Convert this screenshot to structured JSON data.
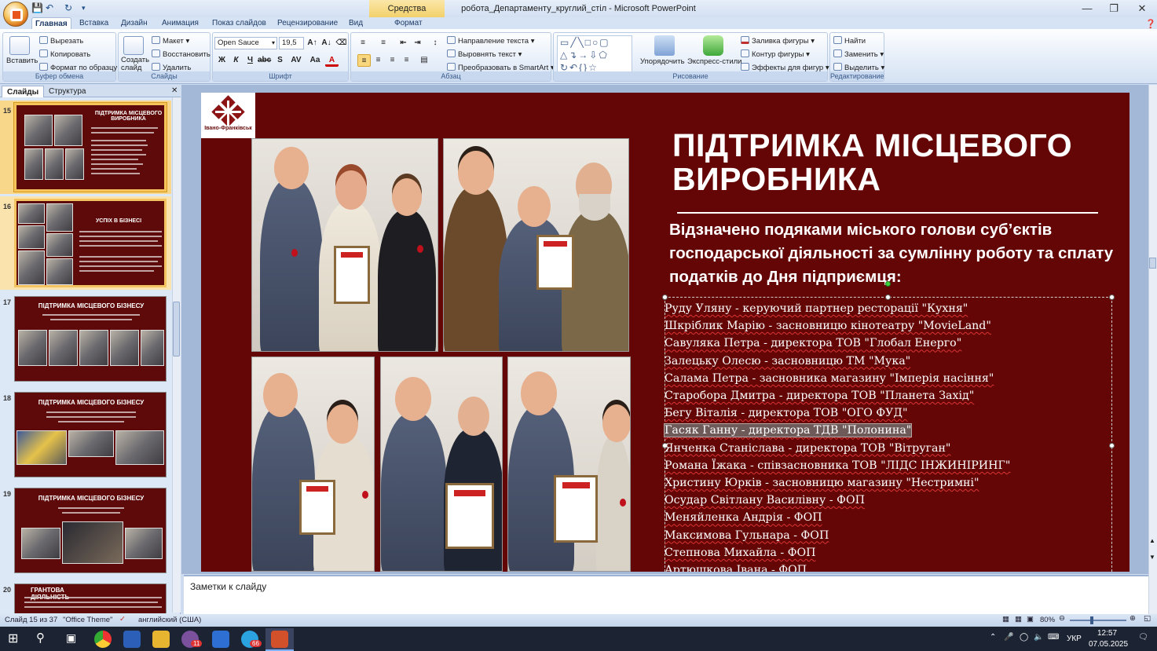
{
  "window": {
    "title": "робота_Департаменту_круглий_стіл - Microsoft PowerPoint",
    "context_tab": "Средства рисования",
    "context_subtab": "Формат"
  },
  "ribbon": {
    "tabs": [
      "Главная",
      "Вставка",
      "Дизайн",
      "Анимация",
      "Показ слайдов",
      "Рецензирование",
      "Вид"
    ],
    "clipboard": {
      "paste": "Вставить",
      "cut": "Вырезать",
      "copy": "Копировать",
      "format_painter": "Формат по образцу",
      "label": "Буфер обмена"
    },
    "slides": {
      "new_slide": "Создать слайд",
      "layout": "Макет",
      "reset": "Восстановить",
      "delete": "Удалить",
      "label": "Слайды"
    },
    "font": {
      "name": "Open Sauce",
      "size": "19,5",
      "label": "Шрифт"
    },
    "paragraph": {
      "text_direction": "Направление текста",
      "align_text": "Выровнять текст",
      "smartart": "Преобразовать в SmartArt",
      "label": "Абзац"
    },
    "drawing": {
      "arrange": "Упорядочить",
      "quick_styles": "Экспресс-стили",
      "fill": "Заливка фигуры",
      "outline": "Контур фигуры",
      "effects": "Эффекты для фигур",
      "label": "Рисование"
    },
    "editing": {
      "find": "Найти",
      "replace": "Заменить",
      "select": "Выделить",
      "label": "Редактирование"
    }
  },
  "panel": {
    "tabs": [
      "Слайды",
      "Структура"
    ],
    "thumbnails": [
      {
        "num": "15",
        "title": "ПІДТРИМКА МІСЦЕВОГО ВИРОБНИКА"
      },
      {
        "num": "16",
        "title": "УСПІХ В БІЗНЕСІ"
      },
      {
        "num": "17",
        "title": "ПІДТРИМКА МІСЦЕВОГО БІЗНЕСУ"
      },
      {
        "num": "18",
        "title": "ПІДТРИМКА МІСЦЕВОГО БІЗНЕСУ"
      },
      {
        "num": "19",
        "title": "ПІДТРИМКА МІСЦЕВОГО БІЗНЕСУ"
      },
      {
        "num": "20",
        "title": "ГРАНТОВА ДІЯЛЬНІСТЬ"
      }
    ]
  },
  "slide": {
    "logo_text": "Івано-Франківськ",
    "title": "ПІДТРИМКА МІСЦЕВОГО ВИРОБНИКА",
    "subtitle": "Відзначено подяками міського голови   суб’єктів господарської діяльності  за сумлінну  роботу та сплату податків до  Дня підприємця:",
    "recipients": [
      "Руду Уляну - керуючий партнер ресторації \"Кухня\"",
      "Шкріблик Марію - засновницю кінотеатру \"MovieLand\"",
      "Савуляка Петра - директора ТОВ \"Глобал Енерго\"",
      "Залецьку Олесю - засновницю ТМ \"Мука\"",
      "Салама Петра - засновника магазину \"Імперія насіння\"",
      "Старобора Дмитра - директора ТОВ \"Планета Захід\"",
      "Бегу Віталія - директора ТОВ \"ОГО ФУД\"",
      "Гасяк Ганну - директора ТДВ \"Полонина\"",
      "Янченка Станіслава - директора ТОВ \"Вітруган\"",
      "Романа Їжака - співзасновника ТОВ \"ЛІДС ІНЖИНІРИНГ\"",
      "Христину Юрків - засновницю магазину \"Нестримні\"",
      "Осудар Світлану Василівну - ФОП",
      "Меняйленка Андрія - ФОП",
      "Максимова Гульнара - ФОП",
      "Степнова Михайла - ФОП",
      "Артюшкова Івана - ФОП"
    ]
  },
  "notes": {
    "placeholder": "Заметки к слайду"
  },
  "status": {
    "slide_counter": "Слайд 15 из 37",
    "theme": "\"Office Theme\"",
    "language": "английский (США)",
    "zoom": "80%"
  },
  "taskbar": {
    "language": "УКР",
    "time": "12:57",
    "date": "07.05.2025",
    "badge_viber": "11",
    "badge_telegram": "66"
  }
}
